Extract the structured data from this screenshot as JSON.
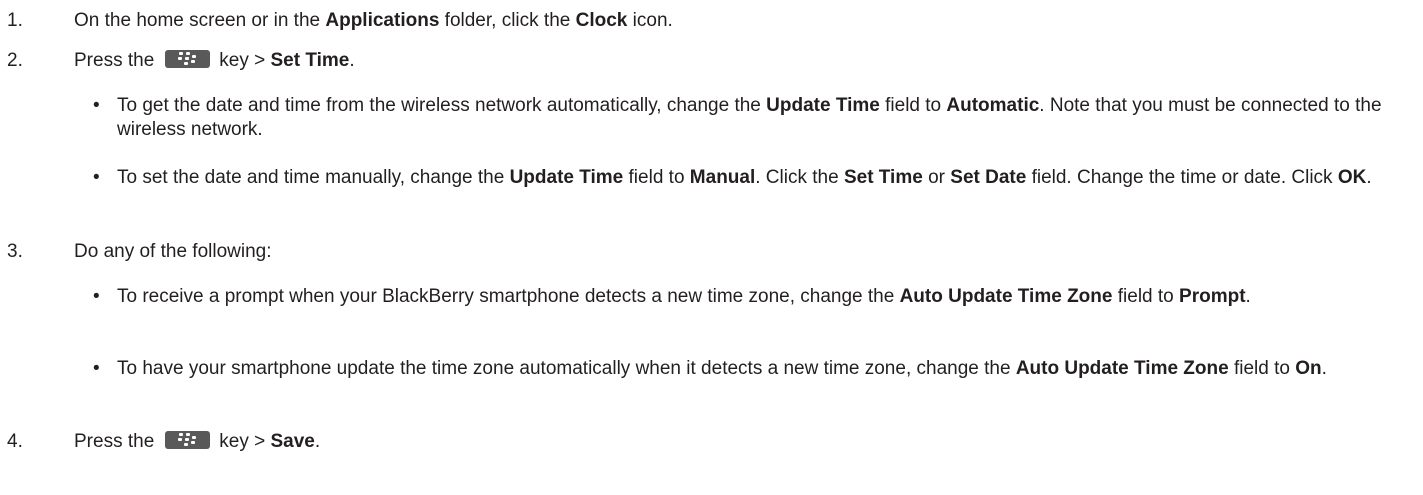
{
  "steps": [
    {
      "number": "1.",
      "text": [
        {
          "t": "On the home screen or in the "
        },
        {
          "t": "Applications",
          "b": true
        },
        {
          "t": " folder, click the "
        },
        {
          "t": "Clock",
          "b": true
        },
        {
          "t": " icon."
        }
      ]
    },
    {
      "number": "2.",
      "pre": "Press the",
      "key_icon": "blackberry-menu-key-icon",
      "post": [
        {
          "t": "key > "
        },
        {
          "t": "Set Time",
          "b": true
        },
        {
          "t": "."
        }
      ],
      "bullets": [
        [
          {
            "t": "To get the date and time from the wireless network automatically, change the "
          },
          {
            "t": "Update Time",
            "b": true
          },
          {
            "t": " field to "
          },
          {
            "t": "Automatic",
            "b": true
          },
          {
            "t": ". Note that you must be connected to the wireless network."
          }
        ],
        [
          {
            "t": "To set the date and time manually, change the "
          },
          {
            "t": "Update Time",
            "b": true
          },
          {
            "t": " field to "
          },
          {
            "t": "Manual",
            "b": true
          },
          {
            "t": ". Click the "
          },
          {
            "t": "Set Time",
            "b": true
          },
          {
            "t": " or "
          },
          {
            "t": "Set Date",
            "b": true
          },
          {
            "t": " field. Change the time or date. Click "
          },
          {
            "t": "OK",
            "b": true
          },
          {
            "t": "."
          }
        ]
      ]
    },
    {
      "number": "3.",
      "text": [
        {
          "t": "Do any of the following:"
        }
      ],
      "bullets": [
        [
          {
            "t": "To receive a prompt when your BlackBerry smartphone detects a new time zone, change the "
          },
          {
            "t": "Auto Update Time Zone",
            "b": true
          },
          {
            "t": " field to "
          },
          {
            "t": "Prompt",
            "b": true
          },
          {
            "t": "."
          }
        ],
        [
          {
            "t": "To have your smartphone update the time zone automatically when it detects a new time zone, change the "
          },
          {
            "t": "Auto Update Time Zone",
            "b": true
          },
          {
            "t": " field to "
          },
          {
            "t": "On",
            "b": true
          },
          {
            "t": "."
          }
        ]
      ]
    },
    {
      "number": "4.",
      "pre": "Press the",
      "key_icon": "blackberry-menu-key-icon",
      "post": [
        {
          "t": "key > "
        },
        {
          "t": "Save",
          "b": true
        },
        {
          "t": "."
        }
      ]
    }
  ],
  "bullet_char": "•",
  "colors": {
    "text": "#231f20",
    "key_bg": "#595959",
    "key_fg": "#ffffff"
  }
}
